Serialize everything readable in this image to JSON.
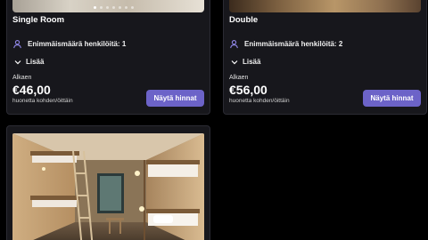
{
  "cards": [
    {
      "title": "Single Room",
      "capacity": "Enimmäismäärä henkilöitä: 1",
      "more": "Lisää",
      "from": "Alkaen",
      "price": "€46,00",
      "per": "huonetta kohden/öittäin",
      "button": "Näytä hinnat",
      "photo_dots": 7,
      "active_dot": 1
    },
    {
      "title": "Double",
      "capacity": "Enimmäismäärä henkilöitä: 2",
      "more": "Lisää",
      "from": "Alkaen",
      "price": "€56,00",
      "per": "huonetta kohden/öittäin",
      "button": "Näytä hinnat"
    },
    {
      "title": "",
      "photo": "bunk-bed-room"
    }
  ],
  "colors": {
    "page_bg": "#000000",
    "card_bg": "#17171c",
    "accent": "#6c63c8",
    "icon_purple": "#8f86e6"
  },
  "icons": {
    "capacity": "user-icon",
    "more": "chevron-down-icon"
  }
}
